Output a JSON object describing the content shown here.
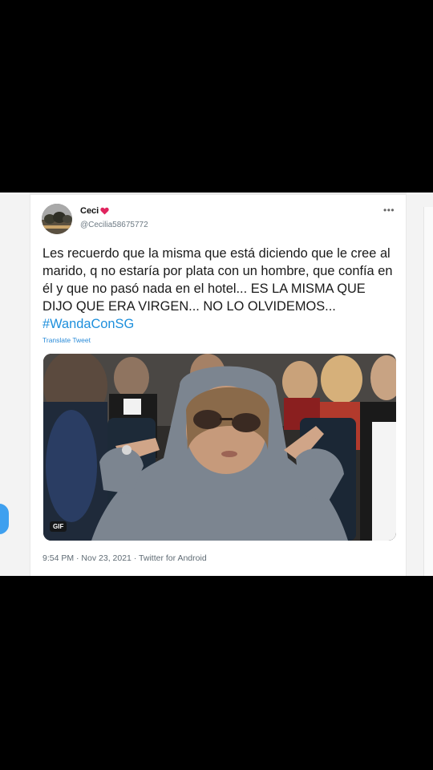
{
  "tweet": {
    "author_name": "Ceci",
    "handle": "@Cecilia58675772",
    "more_icon": "•••",
    "text_main": "Les recuerdo que la misma que está diciendo que le cree al marido, q no estaría por plata con un hombre, que confía en él y que no pasó nada en el hotel... ES LA MISMA QUE DIJO QUE ERA VIRGEN... NO LO OLVIDEMOS... ",
    "hashtag": "#WandaConSG",
    "translate_label": "Translate Tweet",
    "media_badge": "GIF",
    "timestamp": "9:54 PM · Nov 23, 2021 · Twitter for Android"
  },
  "colors": {
    "hashtag": "#1d8fdc",
    "heart": "#e0245e",
    "blue_dot": "#3fa0ef"
  },
  "icons": [
    "heart-icon",
    "more-options-icon"
  ]
}
